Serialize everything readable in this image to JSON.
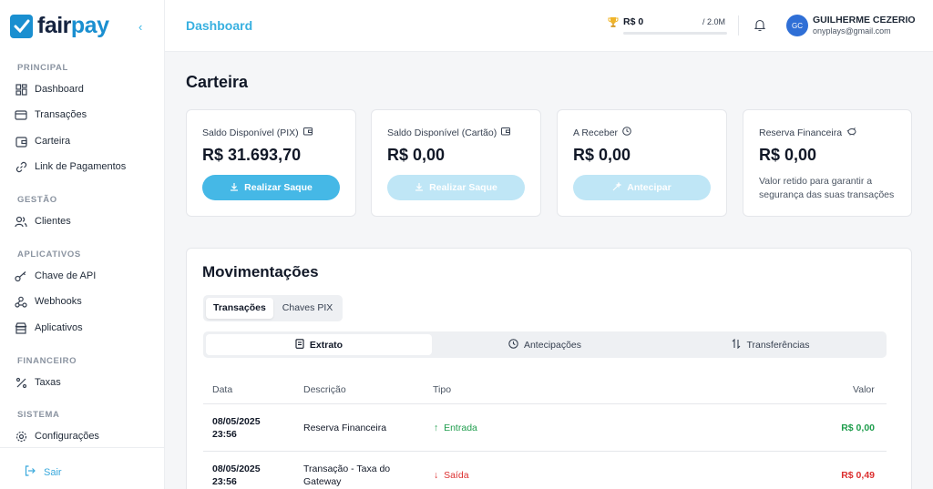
{
  "brand": {
    "name_dark": "fair",
    "name_accent": "pay"
  },
  "sidebar": {
    "sections": [
      "PRINCIPAL",
      "GESTÃO",
      "APLICATIVOS",
      "FINANCEIRO",
      "SISTEMA"
    ],
    "items": [
      {
        "label": "Dashboard",
        "icon": "grid-icon"
      },
      {
        "label": "Transações",
        "icon": "credit-card-icon"
      },
      {
        "label": "Carteira",
        "icon": "wallet-icon"
      },
      {
        "label": "Link de Pagamentos",
        "icon": "link-icon"
      },
      {
        "label": "Clientes",
        "icon": "users-icon"
      },
      {
        "label": "Chave de API",
        "icon": "key-icon"
      },
      {
        "label": "Webhooks",
        "icon": "webhook-icon"
      },
      {
        "label": "Aplicativos",
        "icon": "store-icon"
      },
      {
        "label": "Taxas",
        "icon": "percent-icon"
      },
      {
        "label": "Configurações",
        "icon": "gear-icon"
      }
    ],
    "logout": "Sair"
  },
  "header": {
    "title": "Dashboard",
    "goal_current": "R$ 0",
    "goal_total": "/ 2.0M",
    "goal_progress": 0,
    "user_initials": "GC",
    "user_name": "GUILHERME CEZERIO",
    "user_email": "onyplays@gmail.com"
  },
  "wallet": {
    "title": "Carteira",
    "cards": [
      {
        "label": "Saldo Disponível (PIX)",
        "value": "R$ 31.693,70",
        "button": "Realizar Saque"
      },
      {
        "label": "Saldo Disponível (Cartão)",
        "value": "R$ 0,00",
        "button": "Realizar Saque"
      },
      {
        "label": "A Receber",
        "value": "R$ 0,00",
        "button": "Antecipar"
      },
      {
        "label": "Reserva Financeira",
        "value": "R$ 0,00",
        "note": "Valor retido para garantir a segurança das suas transações"
      }
    ]
  },
  "movements": {
    "title": "Movimentações",
    "tabs": [
      "Transações",
      "Chaves PIX"
    ],
    "subtabs": [
      "Extrato",
      "Antecipações",
      "Transferências"
    ],
    "columns": {
      "date": "Data",
      "desc": "Descrição",
      "type": "Tipo",
      "value": "Valor"
    },
    "rows": [
      {
        "date": "08/05/2025",
        "time": "23:56",
        "desc1": "Reserva Financeira",
        "desc2": "",
        "type": "Entrada",
        "value": "R$ 0,00"
      },
      {
        "date": "08/05/2025",
        "time": "23:56",
        "desc1": "Transação - Taxa do",
        "desc2": "Gateway",
        "type": "Saída",
        "value": "R$ 0,49"
      }
    ]
  },
  "colors": {
    "accent": "#38b0e0",
    "brand": "#1a8fd0",
    "positive": "#1f9d4d",
    "negative": "#dc2f2f"
  }
}
